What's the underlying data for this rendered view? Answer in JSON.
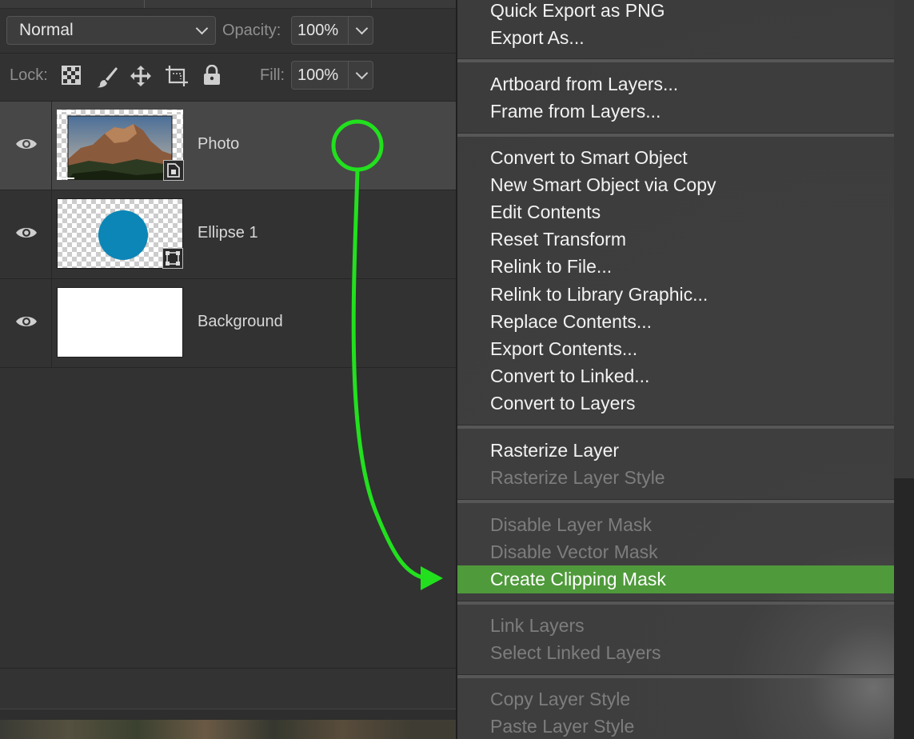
{
  "layers_panel": {
    "blend_mode": "Normal",
    "opacity_label": "Opacity:",
    "opacity_value": "100%",
    "lock_label": "Lock:",
    "fill_label": "Fill:",
    "fill_value": "100%",
    "layers": [
      {
        "name": "Photo",
        "selected": true,
        "thumbnail": "photo-landscape"
      },
      {
        "name": "Ellipse 1",
        "selected": false,
        "thumbnail": "blue-circle-on-transparency"
      },
      {
        "name": "Background",
        "selected": false,
        "thumbnail": "white"
      }
    ]
  },
  "context_menu": {
    "groups": [
      [
        "Quick Export as PNG",
        "Export As..."
      ],
      [
        "Artboard from Layers...",
        "Frame from Layers..."
      ],
      [
        "Convert to Smart Object",
        "New Smart Object via Copy",
        "Edit Contents",
        "Reset Transform",
        "Relink to File...",
        "Relink to Library Graphic...",
        "Replace Contents...",
        "Export Contents...",
        "Convert to Linked...",
        "Convert to Layers"
      ],
      [
        "Rasterize Layer",
        "Rasterize Layer Style"
      ],
      [
        "Disable Layer Mask",
        "Disable Vector Mask",
        "Create Clipping Mask"
      ],
      [
        "Link Layers",
        "Select Linked Layers"
      ],
      [
        "Copy Layer Style",
        "Paste Layer Style"
      ]
    ],
    "disabled_items": [
      "Rasterize Layer Style",
      "Disable Layer Mask",
      "Disable Vector Mask",
      "Link Layers",
      "Select Linked Layers",
      "Copy Layer Style",
      "Paste Layer Style"
    ],
    "highlighted_item": "Create Clipping Mask"
  },
  "colors": {
    "panel_bg": "#323232",
    "selected_layer_bg": "#474747",
    "menu_bg": "#3c3c3c",
    "menu_highlight": "#4f9a3b",
    "annotation_green": "#22e01e",
    "ellipse_blue": "#0b86b6"
  },
  "icons": {
    "visibility": "eye-icon",
    "lock_transparent": "checkerboard-lock-icon",
    "lock_paint": "brush-icon",
    "lock_position": "move-icon",
    "lock_artboard": "artboard-crop-icon",
    "lock_all": "padlock-icon",
    "smart_object_badge": "smart-object-icon",
    "shape_badge": "vector-shape-icon"
  }
}
